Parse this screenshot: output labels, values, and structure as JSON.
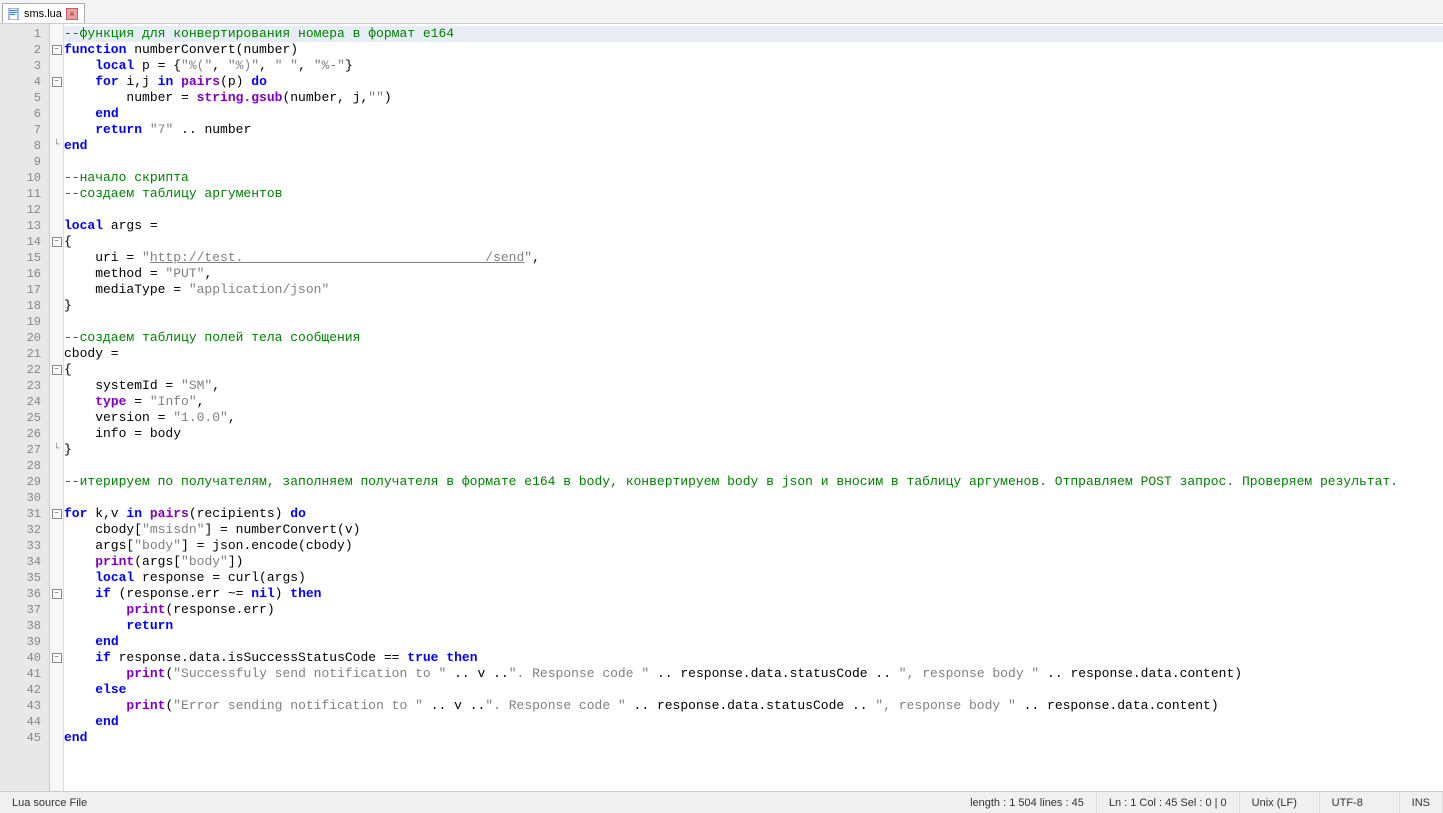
{
  "tab": {
    "filename": "sms.lua"
  },
  "editor": {
    "total_lines": 45,
    "active_line": 1,
    "fold_markers": {
      "2": "open",
      "4": "open",
      "14": "open",
      "22": "open",
      "31": "open",
      "36": "open",
      "40": "open"
    },
    "fold_ends": {
      "8": true,
      "27": true
    },
    "lines": [
      {
        "n": 1,
        "tokens": [
          {
            "t": "--функция для конвертирования номера в формат е164",
            "c": "c-comment"
          }
        ]
      },
      {
        "n": 2,
        "tokens": [
          {
            "t": "function",
            "c": "c-keyword"
          },
          {
            "t": " numberConvert(number)",
            "c": "c-ident"
          }
        ]
      },
      {
        "n": 3,
        "tokens": [
          {
            "t": "    ",
            "c": ""
          },
          {
            "t": "local",
            "c": "c-keyword"
          },
          {
            "t": " p = {",
            "c": "c-ident"
          },
          {
            "t": "\"%(\"",
            "c": "c-string"
          },
          {
            "t": ", ",
            "c": "c-ident"
          },
          {
            "t": "\"%)\"",
            "c": "c-string"
          },
          {
            "t": ", ",
            "c": "c-ident"
          },
          {
            "t": "\" \"",
            "c": "c-string"
          },
          {
            "t": ", ",
            "c": "c-ident"
          },
          {
            "t": "\"%-\"",
            "c": "c-string"
          },
          {
            "t": "}",
            "c": "c-ident"
          }
        ]
      },
      {
        "n": 4,
        "tokens": [
          {
            "t": "    ",
            "c": ""
          },
          {
            "t": "for",
            "c": "c-keyword"
          },
          {
            "t": " i,j ",
            "c": "c-ident"
          },
          {
            "t": "in",
            "c": "c-keyword"
          },
          {
            "t": " ",
            "c": ""
          },
          {
            "t": "pairs",
            "c": "c-builtin"
          },
          {
            "t": "(p) ",
            "c": "c-ident"
          },
          {
            "t": "do",
            "c": "c-keyword"
          }
        ]
      },
      {
        "n": 5,
        "tokens": [
          {
            "t": "        number = ",
            "c": "c-ident"
          },
          {
            "t": "string.gsub",
            "c": "c-builtin"
          },
          {
            "t": "(number, j,",
            "c": "c-ident"
          },
          {
            "t": "\"\"",
            "c": "c-string"
          },
          {
            "t": ")",
            "c": "c-ident"
          }
        ]
      },
      {
        "n": 6,
        "tokens": [
          {
            "t": "    ",
            "c": ""
          },
          {
            "t": "end",
            "c": "c-keyword"
          }
        ]
      },
      {
        "n": 7,
        "tokens": [
          {
            "t": "    ",
            "c": ""
          },
          {
            "t": "return",
            "c": "c-keyword"
          },
          {
            "t": " ",
            "c": ""
          },
          {
            "t": "\"7\"",
            "c": "c-string"
          },
          {
            "t": " .. number",
            "c": "c-ident"
          }
        ]
      },
      {
        "n": 8,
        "tokens": [
          {
            "t": "end",
            "c": "c-keyword"
          }
        ]
      },
      {
        "n": 9,
        "tokens": [
          {
            "t": "",
            "c": ""
          }
        ]
      },
      {
        "n": 10,
        "tokens": [
          {
            "t": "--начало скрипта",
            "c": "c-comment"
          }
        ]
      },
      {
        "n": 11,
        "tokens": [
          {
            "t": "--создаем таблицу аргументов",
            "c": "c-comment"
          }
        ]
      },
      {
        "n": 12,
        "tokens": [
          {
            "t": "",
            "c": ""
          }
        ]
      },
      {
        "n": 13,
        "tokens": [
          {
            "t": "local",
            "c": "c-keyword"
          },
          {
            "t": " args =",
            "c": "c-ident"
          }
        ]
      },
      {
        "n": 14,
        "tokens": [
          {
            "t": "{",
            "c": "c-ident"
          }
        ]
      },
      {
        "n": 15,
        "tokens": [
          {
            "t": "    uri = ",
            "c": "c-ident"
          },
          {
            "t": "\"",
            "c": "c-string"
          },
          {
            "t": "http://test.                               /send",
            "c": "c-url"
          },
          {
            "t": "\"",
            "c": "c-string"
          },
          {
            "t": ",",
            "c": "c-ident"
          }
        ]
      },
      {
        "n": 16,
        "tokens": [
          {
            "t": "    method = ",
            "c": "c-ident"
          },
          {
            "t": "\"PUT\"",
            "c": "c-string"
          },
          {
            "t": ",",
            "c": "c-ident"
          }
        ]
      },
      {
        "n": 17,
        "tokens": [
          {
            "t": "    mediaType = ",
            "c": "c-ident"
          },
          {
            "t": "\"application/json\"",
            "c": "c-string"
          }
        ]
      },
      {
        "n": 18,
        "tokens": [
          {
            "t": "}",
            "c": "c-ident"
          }
        ]
      },
      {
        "n": 19,
        "tokens": [
          {
            "t": "",
            "c": ""
          }
        ]
      },
      {
        "n": 20,
        "tokens": [
          {
            "t": "--создаем таблицу полей тела сообщения",
            "c": "c-comment"
          }
        ]
      },
      {
        "n": 21,
        "tokens": [
          {
            "t": "cbody =",
            "c": "c-ident"
          }
        ]
      },
      {
        "n": 22,
        "tokens": [
          {
            "t": "{",
            "c": "c-ident"
          }
        ]
      },
      {
        "n": 23,
        "tokens": [
          {
            "t": "    systemId = ",
            "c": "c-ident"
          },
          {
            "t": "\"SM\"",
            "c": "c-string"
          },
          {
            "t": ",",
            "c": "c-ident"
          }
        ]
      },
      {
        "n": 24,
        "tokens": [
          {
            "t": "    ",
            "c": ""
          },
          {
            "t": "type",
            "c": "c-builtin"
          },
          {
            "t": " = ",
            "c": "c-ident"
          },
          {
            "t": "\"Info\"",
            "c": "c-string"
          },
          {
            "t": ",",
            "c": "c-ident"
          }
        ]
      },
      {
        "n": 25,
        "tokens": [
          {
            "t": "    version = ",
            "c": "c-ident"
          },
          {
            "t": "\"1.0.0\"",
            "c": "c-string"
          },
          {
            "t": ",",
            "c": "c-ident"
          }
        ]
      },
      {
        "n": 26,
        "tokens": [
          {
            "t": "    info = body",
            "c": "c-ident"
          }
        ]
      },
      {
        "n": 27,
        "tokens": [
          {
            "t": "}",
            "c": "c-ident"
          }
        ]
      },
      {
        "n": 28,
        "tokens": [
          {
            "t": "",
            "c": ""
          }
        ]
      },
      {
        "n": 29,
        "tokens": [
          {
            "t": "--итерируем по получателям, заполняем получателя в формате е164 в body, конвертируем body в json и вносим в таблицу аргуменов. Отправляем POST запрос. Проверяем результат.",
            "c": "c-comment"
          }
        ]
      },
      {
        "n": 30,
        "tokens": [
          {
            "t": "",
            "c": ""
          }
        ]
      },
      {
        "n": 31,
        "tokens": [
          {
            "t": "for",
            "c": "c-keyword"
          },
          {
            "t": " k,v ",
            "c": "c-ident"
          },
          {
            "t": "in",
            "c": "c-keyword"
          },
          {
            "t": " ",
            "c": ""
          },
          {
            "t": "pairs",
            "c": "c-builtin"
          },
          {
            "t": "(recipients) ",
            "c": "c-ident"
          },
          {
            "t": "do",
            "c": "c-keyword"
          }
        ]
      },
      {
        "n": 32,
        "tokens": [
          {
            "t": "    cbody[",
            "c": "c-ident"
          },
          {
            "t": "\"msisdn\"",
            "c": "c-string"
          },
          {
            "t": "] = numberConvert(v)",
            "c": "c-ident"
          }
        ]
      },
      {
        "n": 33,
        "tokens": [
          {
            "t": "    args[",
            "c": "c-ident"
          },
          {
            "t": "\"body\"",
            "c": "c-string"
          },
          {
            "t": "] = json.encode(cbody)",
            "c": "c-ident"
          }
        ]
      },
      {
        "n": 34,
        "tokens": [
          {
            "t": "    ",
            "c": ""
          },
          {
            "t": "print",
            "c": "c-builtin"
          },
          {
            "t": "(args[",
            "c": "c-ident"
          },
          {
            "t": "\"body\"",
            "c": "c-string"
          },
          {
            "t": "])",
            "c": "c-ident"
          }
        ]
      },
      {
        "n": 35,
        "tokens": [
          {
            "t": "    ",
            "c": ""
          },
          {
            "t": "local",
            "c": "c-keyword"
          },
          {
            "t": " response = curl(args)",
            "c": "c-ident"
          }
        ]
      },
      {
        "n": 36,
        "tokens": [
          {
            "t": "    ",
            "c": ""
          },
          {
            "t": "if",
            "c": "c-keyword"
          },
          {
            "t": " (response.err ~= ",
            "c": "c-ident"
          },
          {
            "t": "nil",
            "c": "c-keyword"
          },
          {
            "t": ") ",
            "c": "c-ident"
          },
          {
            "t": "then",
            "c": "c-keyword"
          }
        ]
      },
      {
        "n": 37,
        "tokens": [
          {
            "t": "        ",
            "c": ""
          },
          {
            "t": "print",
            "c": "c-builtin"
          },
          {
            "t": "(response.err)",
            "c": "c-ident"
          }
        ]
      },
      {
        "n": 38,
        "tokens": [
          {
            "t": "        ",
            "c": ""
          },
          {
            "t": "return",
            "c": "c-keyword"
          }
        ]
      },
      {
        "n": 39,
        "tokens": [
          {
            "t": "    ",
            "c": ""
          },
          {
            "t": "end",
            "c": "c-keyword"
          }
        ]
      },
      {
        "n": 40,
        "tokens": [
          {
            "t": "    ",
            "c": ""
          },
          {
            "t": "if",
            "c": "c-keyword"
          },
          {
            "t": " response.data.isSuccessStatusCode == ",
            "c": "c-ident"
          },
          {
            "t": "true",
            "c": "c-keyword"
          },
          {
            "t": " ",
            "c": ""
          },
          {
            "t": "then",
            "c": "c-keyword"
          }
        ]
      },
      {
        "n": 41,
        "tokens": [
          {
            "t": "        ",
            "c": ""
          },
          {
            "t": "print",
            "c": "c-builtin"
          },
          {
            "t": "(",
            "c": "c-ident"
          },
          {
            "t": "\"Successfuly send notification to \"",
            "c": "c-string"
          },
          {
            "t": " .. v ..",
            "c": "c-ident"
          },
          {
            "t": "\". Response code \"",
            "c": "c-string"
          },
          {
            "t": " .. response.data.statusCode .. ",
            "c": "c-ident"
          },
          {
            "t": "\", response body \"",
            "c": "c-string"
          },
          {
            "t": " .. response.data.content)",
            "c": "c-ident"
          }
        ]
      },
      {
        "n": 42,
        "tokens": [
          {
            "t": "    ",
            "c": ""
          },
          {
            "t": "else",
            "c": "c-keyword"
          }
        ]
      },
      {
        "n": 43,
        "tokens": [
          {
            "t": "        ",
            "c": ""
          },
          {
            "t": "print",
            "c": "c-builtin"
          },
          {
            "t": "(",
            "c": "c-ident"
          },
          {
            "t": "\"Error sending notification to \"",
            "c": "c-string"
          },
          {
            "t": " .. v ..",
            "c": "c-ident"
          },
          {
            "t": "\". Response code \"",
            "c": "c-string"
          },
          {
            "t": " .. response.data.statusCode .. ",
            "c": "c-ident"
          },
          {
            "t": "\", response body \"",
            "c": "c-string"
          },
          {
            "t": " .. response.data.content)",
            "c": "c-ident"
          }
        ]
      },
      {
        "n": 44,
        "tokens": [
          {
            "t": "    ",
            "c": ""
          },
          {
            "t": "end",
            "c": "c-keyword"
          }
        ]
      },
      {
        "n": 45,
        "tokens": [
          {
            "t": "end",
            "c": "c-keyword"
          }
        ]
      }
    ]
  },
  "status": {
    "filetype": "Lua source File",
    "length": "length : 1 504    lines : 45",
    "position": "Ln : 1    Col : 45    Sel : 0 | 0",
    "eol": "Unix (LF)",
    "encoding": "UTF-8",
    "mode": "INS"
  }
}
